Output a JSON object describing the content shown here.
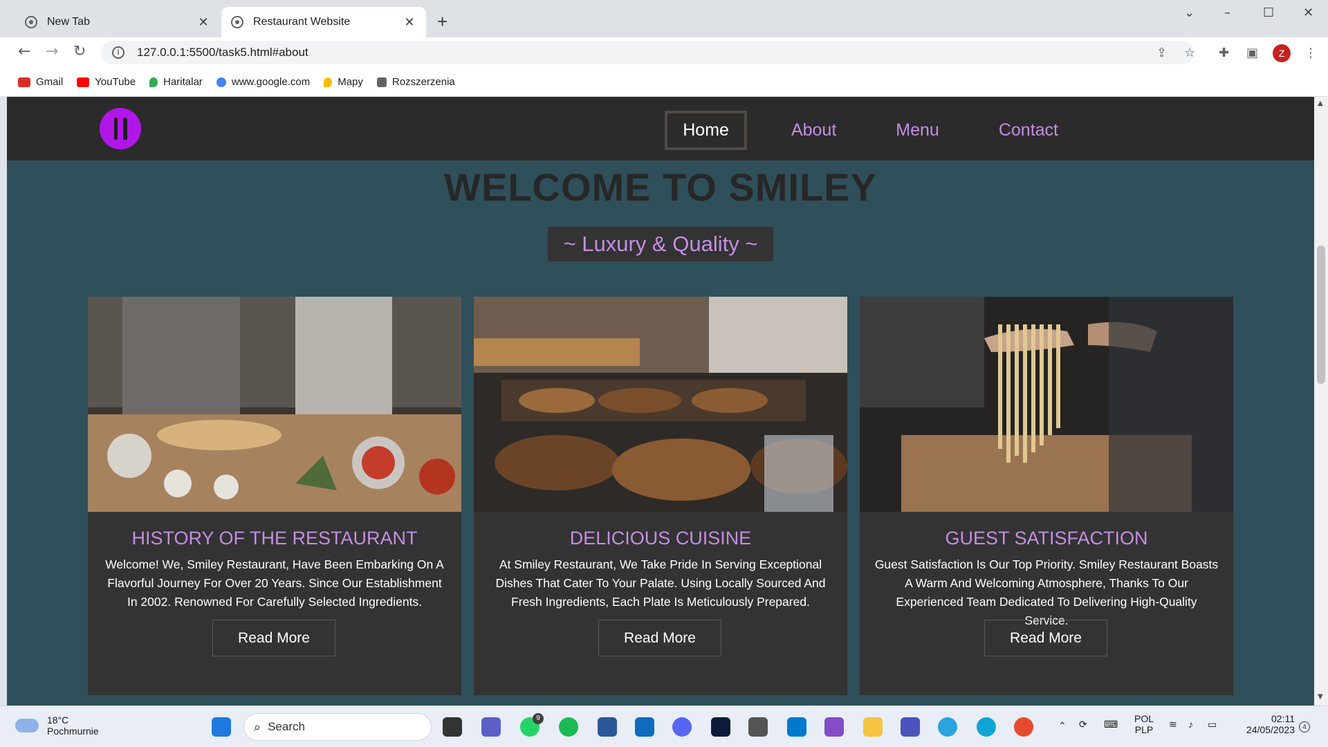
{
  "browser": {
    "tabs": [
      {
        "title": "New Tab"
      },
      {
        "title": "Restaurant Website"
      }
    ],
    "url": "127.0.0.1:5500/task5.html#about",
    "avatar_letter": "Z",
    "bookmarks": [
      {
        "label": "Gmail",
        "color": "#d93025"
      },
      {
        "label": "YouTube",
        "color": "#ff0000"
      },
      {
        "label": "Haritalar",
        "color": "#34a853"
      },
      {
        "label": "www.google.com",
        "color": "#4285f4"
      },
      {
        "label": "Mapy",
        "color": "#fbbc04"
      },
      {
        "label": "Rozszerzenia",
        "color": "#5f6368"
      }
    ]
  },
  "site": {
    "brand_color": "#b016e8",
    "accent_color": "#c38ee3",
    "nav": [
      {
        "label": "Home",
        "active": true
      },
      {
        "label": "About"
      },
      {
        "label": "Menu"
      },
      {
        "label": "Contact"
      }
    ],
    "hero_title": "WELCOME TO SMILEY",
    "tagline": "~ Luxury & Quality ~",
    "cards": [
      {
        "title": "HISTORY OF THE RESTAURANT",
        "text": "Welcome! We, Smiley Restaurant, Have Been Embarking On A Flavorful Journey For Over 20 Years. Since Our Establishment In 2002. Renowned For Carefully Selected Ingredients.",
        "button": "Read More"
      },
      {
        "title": "DELICIOUS CUISINE",
        "text": "At Smiley Restaurant, We Take Pride In Serving Exceptional Dishes That Cater To Your Palate. Using Locally Sourced And Fresh Ingredients, Each Plate Is Meticulously Prepared.",
        "button": "Read More"
      },
      {
        "title": "GUEST SATISFACTION",
        "text": "Guest Satisfaction Is Our Top Priority. Smiley Restaurant Boasts A Warm And Welcoming Atmosphere, Thanks To Our Experienced Team Dedicated To Delivering High-Quality Service.",
        "button": "Read More"
      }
    ]
  },
  "taskbar": {
    "weather_temp": "18°C",
    "weather_desc": "Pochmurnie",
    "search_label": "Search",
    "whatsapp_badge": "9",
    "lang_top": "POL",
    "lang_bottom": "PLP",
    "time": "02:11",
    "date": "24/05/2023",
    "notif_count": "4"
  }
}
